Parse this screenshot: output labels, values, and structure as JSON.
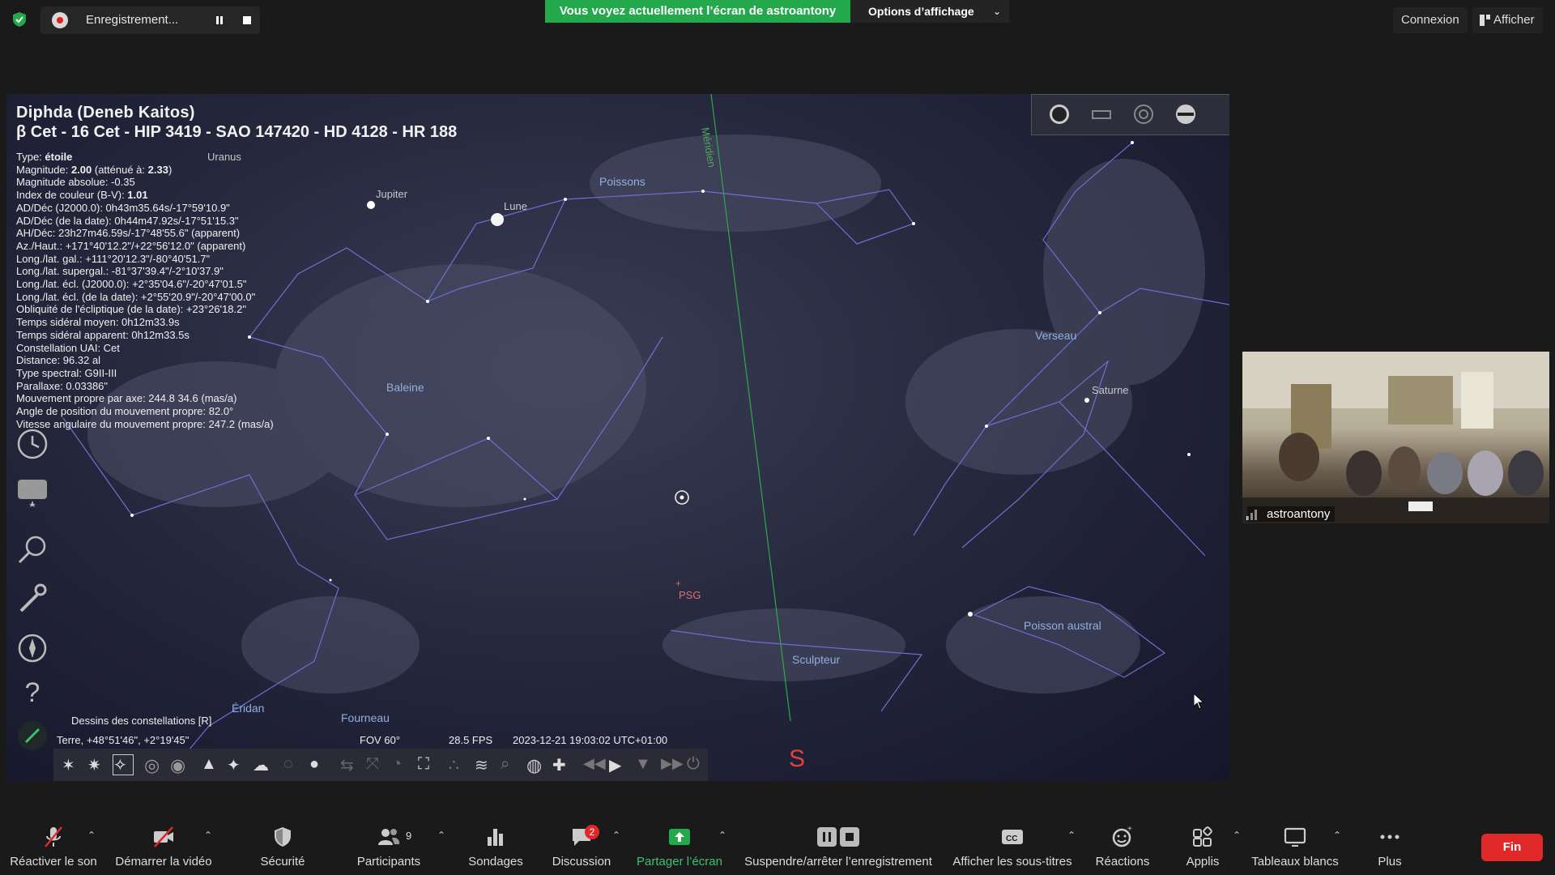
{
  "topbar": {
    "recording_label": "Enregistrement...",
    "share_banner": "Vous voyez actuellement l’écran de astroantony",
    "view_options": "Options d’affichage",
    "connexion": "Connexion",
    "afficher": "Afficher"
  },
  "stellarium": {
    "object_title": "Diphda (Deneb Kaitos)",
    "object_subtitle": "β Cet - 16 Cet - HIP 3419 - SAO 147420 - HD 4128 - HR 188",
    "info": {
      "type_label": "Type: ",
      "type_value": "étoile",
      "mag_label": "Magnitude: ",
      "mag_value": "2.00",
      "mag_mid": " (atténué à: ",
      "mag_ext": "2.33",
      "mag_end": ")",
      "abs_mag": "Magnitude absolue: -0.35",
      "ci_label": "Index de couleur (B-V): ",
      "ci_value": "1.01",
      "l1": "AD/Déc (J2000.0): 0h43m35.64s/-17°59'10.9\"",
      "l2": "AD/Déc (de la date): 0h44m47.92s/-17°51'15.3\"",
      "l3": "AH/Déc: 23h27m46.59s/-17°48'55.6\" (apparent)",
      "l4": "Az./Haut.: +171°40'12.2\"/+22°56'12.0\" (apparent)",
      "l5": "Long./lat. gal.: +111°20'12.3\"/-80°40'51.7\"",
      "l6": "Long./lat. supergal.: -81°37'39.4\"/-2°10'37.9\"",
      "l7": "Long./lat. écl. (J2000.0): +2°35'04.6\"/-20°47'01.5\"",
      "l8": "Long./lat. écl. (de la date): +2°55'20.9\"/-20°47'00.0\"",
      "l9": "Obliquité de l'écliptique (de la date): +23°26'18.2\"",
      "l10": "Temps sidéral moyen: 0h12m33.9s",
      "l11": "Temps sidéral apparent: 0h12m33.5s",
      "l12": "Constellation UAI: Cet",
      "l13": "Distance: 96.32 al",
      "l14": "Type spectral: G9II-III",
      "l15": "Parallaxe: 0.03386\"",
      "l16": "Mouvement propre par axe: 244.8 34.6 (mas/a)",
      "l17": "Angle de position du mouvement propre: 82.0°",
      "l18": "Vitesse angulaire du mouvement propre: 247.2 (mas/a)"
    },
    "labels": {
      "uranus": "Uranus",
      "jupiter": "Jupiter",
      "lune": "Lune",
      "poissons": "Poissons",
      "meridien": "Méridien",
      "baleine": "Baleine",
      "verseau": "Verseau",
      "saturne": "Saturne",
      "psg": "PSG",
      "sculpteur": "Sculpteur",
      "poisson_austral": "Poisson austral",
      "eridan": "Éridan",
      "fourneau": "Fourneau"
    },
    "hint": "Dessins des constellations  [R]",
    "location": "Terre, +48°51'46\", +2°19'45\"",
    "fov": "FOV 60°",
    "fps": "28.5 FPS",
    "datetime": "2023-12-21 19:03:02 UTC+01:00",
    "south": "S"
  },
  "video": {
    "name": "astroantony"
  },
  "bottombar": {
    "unmute": "Réactiver le son",
    "start_video": "Démarrer la vidéo",
    "security": "Sécurité",
    "participants": "Participants",
    "participants_count": "9",
    "polls": "Sondages",
    "chat": "Discussion",
    "chat_badge": "2",
    "share": "Partager l’écran",
    "recording": "Suspendre/arrêter l’enregistrement",
    "captions": "Afficher les sous-titres",
    "reactions": "Réactions",
    "apps": "Applis",
    "whiteboards": "Tableaux blancs",
    "more": "Plus",
    "end": "Fin"
  },
  "colors": {
    "share_green": "#23a84b",
    "end_red": "#e02828",
    "sky": "#2a2c42",
    "constellation_line": "#6d6fd0"
  }
}
